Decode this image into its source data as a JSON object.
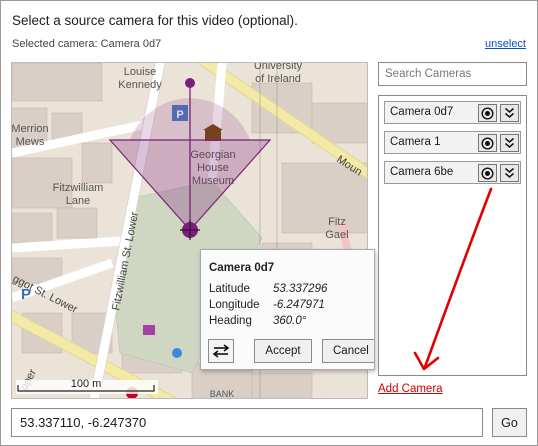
{
  "header": {
    "prompt": "Select a source camera for this video (optional).",
    "selected_camera": "Selected camera: Camera 0d7",
    "unselect_label": "unselect"
  },
  "map": {
    "labels": {
      "louise_kennedy": "Louise\nKennedy",
      "university": "University\nof Ireland",
      "georgian": "Georgian\nHouse\nMuseum",
      "fitzwilliam_lane": "Fitzwilliam\nLane",
      "merrion_mews": "Merrion\nMews",
      "fitzwilliam_st_lower": "Fitzwilliam St. Lower",
      "baggot_st_lower": "ggot St. Lower",
      "upper": "pper",
      "mount": "Moun",
      "fitz_gael": "Fitz\nGael",
      "bank": "BANK\nRELAND",
      "scale": "100 m"
    },
    "accent": "#7a1f7a"
  },
  "popup": {
    "title": "Camera 0d7",
    "latitude_label": "Latitude",
    "latitude_value": "53.337296",
    "longitude_label": "Longitude",
    "longitude_value": "-6.247971",
    "heading_label": "Heading",
    "heading_value": "360.0°",
    "accept_label": "Accept",
    "cancel_label": "Cancel"
  },
  "sidebar": {
    "search_placeholder": "Search Cameras",
    "cameras": [
      {
        "name": "Camera 0d7"
      },
      {
        "name": "Camera 1"
      },
      {
        "name": "Camera 6be"
      }
    ],
    "add_camera_label": "Add Camera"
  },
  "footer": {
    "coords_value": "53.337110, -6.247370",
    "go_label": "Go"
  }
}
